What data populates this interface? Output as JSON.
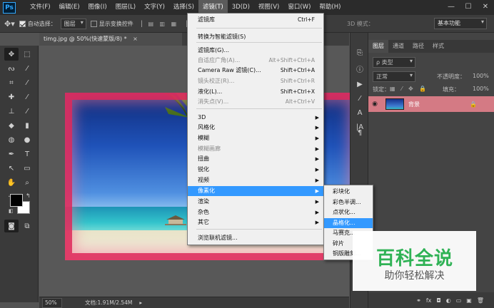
{
  "menubar": {
    "logo": "Ps",
    "items": [
      "文件(F)",
      "编辑(E)",
      "图像(I)",
      "图层(L)",
      "文字(Y)",
      "选择(S)",
      "滤镜(T)",
      "3D(D)",
      "视图(V)",
      "窗口(W)",
      "帮助(H)"
    ],
    "active_item": "滤镜(T)",
    "window_controls": [
      "—",
      "☐",
      "✕"
    ]
  },
  "options_bar": {
    "auto_select_label": "自动选择：",
    "auto_select_checked": true,
    "auto_select_target": "图层",
    "transform_label": "显示变换控件",
    "transform_checked": false,
    "mode_3d_label": "3D 模式：",
    "workspace": "基本功能"
  },
  "document": {
    "tab_title": "timg.jpg @ 50%(快速蒙版/8) *",
    "tab_close": "×",
    "zoom": "50%",
    "doc_info": "文档:1.91M/2.54M"
  },
  "filter_menu": {
    "items": [
      {
        "label": "滤镜库",
        "shortcut": "Ctrl+F",
        "enabled": true
      },
      {
        "label": "转换为智能滤镜(S)",
        "enabled": true
      },
      {
        "label": "滤镜库(G)...",
        "enabled": true
      },
      {
        "label": "自适应广角(A)...",
        "shortcut": "Alt+Shift+Ctrl+A",
        "enabled": false
      },
      {
        "label": "Camera Raw 滤镜(C)...",
        "shortcut": "Shift+Ctrl+A",
        "enabled": true
      },
      {
        "label": "镜头校正(R)...",
        "shortcut": "Shift+Ctrl+R",
        "enabled": false
      },
      {
        "label": "液化(L)...",
        "shortcut": "Shift+Ctrl+X",
        "enabled": true
      },
      {
        "label": "消失点(V)...",
        "shortcut": "Alt+Ctrl+V",
        "enabled": false
      },
      {
        "label": "3D",
        "submenu": true,
        "enabled": true
      },
      {
        "label": "风格化",
        "submenu": true,
        "enabled": true
      },
      {
        "label": "模糊",
        "submenu": true,
        "enabled": true
      },
      {
        "label": "模糊画廊",
        "submenu": true,
        "enabled": false
      },
      {
        "label": "扭曲",
        "submenu": true,
        "enabled": true
      },
      {
        "label": "锐化",
        "submenu": true,
        "enabled": true
      },
      {
        "label": "视频",
        "submenu": true,
        "enabled": true
      },
      {
        "label": "像素化",
        "submenu": true,
        "enabled": true,
        "highlighted": true
      },
      {
        "label": "渲染",
        "submenu": true,
        "enabled": true
      },
      {
        "label": "杂色",
        "submenu": true,
        "enabled": true
      },
      {
        "label": "其它",
        "submenu": true,
        "enabled": true
      },
      {
        "label": "浏览联机滤镜...",
        "enabled": true
      }
    ]
  },
  "pixelate_submenu": {
    "items": [
      {
        "label": "彩块化"
      },
      {
        "label": "彩色半调..."
      },
      {
        "label": "点状化..."
      },
      {
        "label": "晶格化...",
        "highlighted": true
      },
      {
        "label": "马赛克..."
      },
      {
        "label": "碎片"
      },
      {
        "label": "铜版雕刻..."
      }
    ]
  },
  "layers_panel": {
    "tabs": [
      "图层",
      "通道",
      "路径",
      "样式"
    ],
    "active_tab": "图层",
    "filter_kind": "ρ 类型",
    "blend_mode": "正常",
    "opacity_label": "不透明度：",
    "opacity_value": "100%",
    "lock_label": "锁定：",
    "fill_label": "填充：",
    "fill_value": "100%",
    "layer_name": "背景",
    "bottom_icons": [
      "⚭",
      "fx",
      "◘",
      "◐",
      "▭",
      "▣",
      "🗑"
    ]
  },
  "watermark": {
    "title": "百科全说",
    "subtitle": "助你轻松解决"
  },
  "colors": {
    "highlight": "#3399ff",
    "layer_selected": "#d47a84",
    "quick_mask": "#de285a",
    "watermark_green": "#2fb255"
  }
}
